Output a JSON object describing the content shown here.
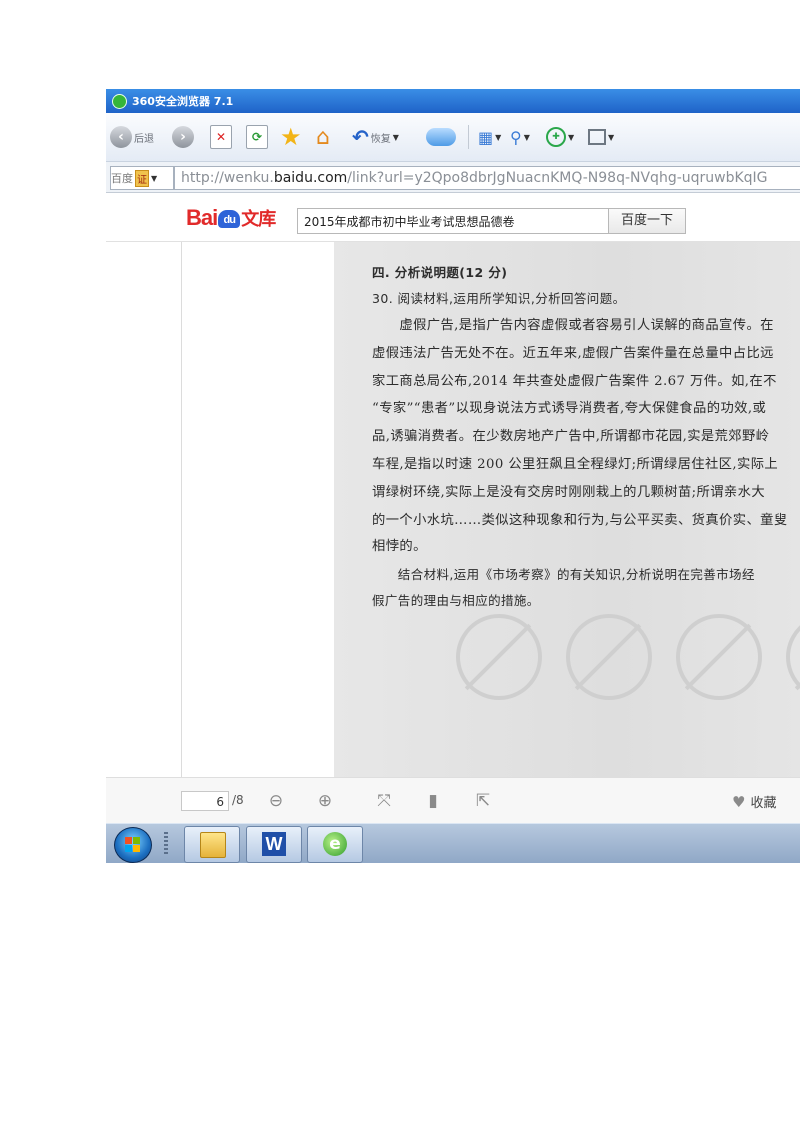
{
  "window": {
    "title": "360安全浏览器 7.1"
  },
  "toolbar": {
    "back_label": "后退",
    "restore_label": "恢复"
  },
  "addressbar": {
    "search_engine": "百度",
    "cert_badge": "证",
    "url_prefix": "http://wenku.",
    "url_domain": "baidu.com",
    "url_rest": "/link?url=y2Qpo8dbrJgNuacnKMQ-N98q-NVqhg-uqruwbKqIG"
  },
  "baidu": {
    "logo_left": "Bai",
    "logo_paw": "du",
    "logo_right": "文库",
    "search_value": "2015年成都市初中毕业考试思想品德卷",
    "search_button": "百度一下"
  },
  "document": {
    "lines": [
      "四. 分析说明题(12 分)",
      "30. 阅读材料,运用所学知识,分析回答问题。",
      "　　虚假广告,是指广告内容虚假或者容易引人误解的商品宣传。在",
      "虚假违法广告无处不在。近五年来,虚假广告案件量在总量中占比远",
      "家工商总局公布,2014 年共查处虚假广告案件 2.67 万件。如,在不",
      "“专家”“患者”以现身说法方式诱导消费者,夸大保健食品的功效,或",
      "品,诱骗消费者。在少数房地产广告中,所谓都市花园,实是荒郊野岭",
      "车程,是指以时速 200 公里狂飙且全程绿灯;所谓绿居住社区,实际上",
      "谓绿树环绕,实际上是没有交房时刚刚栽上的几颗树苗;所谓亲水大",
      "的一个小水坑……类似这种现象和行为,与公平买卖、货真价实、童叟",
      "相悖的。",
      "　　结合材料,运用《市场考察》的有关知识,分析说明在完善市场经",
      "假广告的理由与相应的措施。"
    ]
  },
  "reader": {
    "current_page": "6",
    "total_pages": "/8",
    "collect_label": "收藏"
  },
  "taskbar": {
    "apps": [
      "explorer",
      "wps-writer",
      "360-browser"
    ]
  }
}
